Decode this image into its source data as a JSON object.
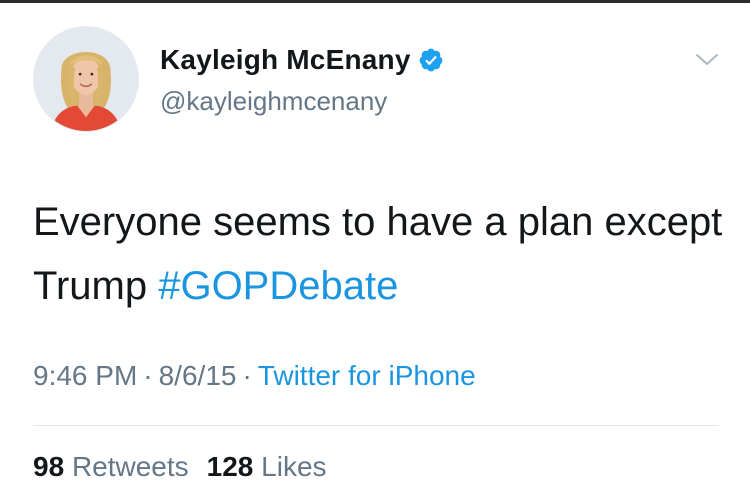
{
  "header": {
    "avatar_icon": "profile-photo",
    "display_name": "Kayleigh McEnany",
    "handle": "@kayleighmcenany",
    "verified_icon": "verified-badge-icon",
    "menu_icon": "chevron-down-icon"
  },
  "tweet": {
    "text_main": "Everyone seems to have a plan except Trump ",
    "hashtag": "#GOPDebate"
  },
  "meta": {
    "time": "9:46 PM",
    "separator_1": "·",
    "date": "8/6/15",
    "separator_2": "·",
    "source": "Twitter for iPhone"
  },
  "stats": {
    "retweets_count": "98",
    "retweets_label": "Retweets",
    "likes_count": "128",
    "likes_label": "Likes"
  },
  "colors": {
    "text": "#14171a",
    "secondary_text": "#657786",
    "link_blue": "#1b95e0",
    "verified_blue": "#1da1f2",
    "divider": "#e1e8ed"
  }
}
